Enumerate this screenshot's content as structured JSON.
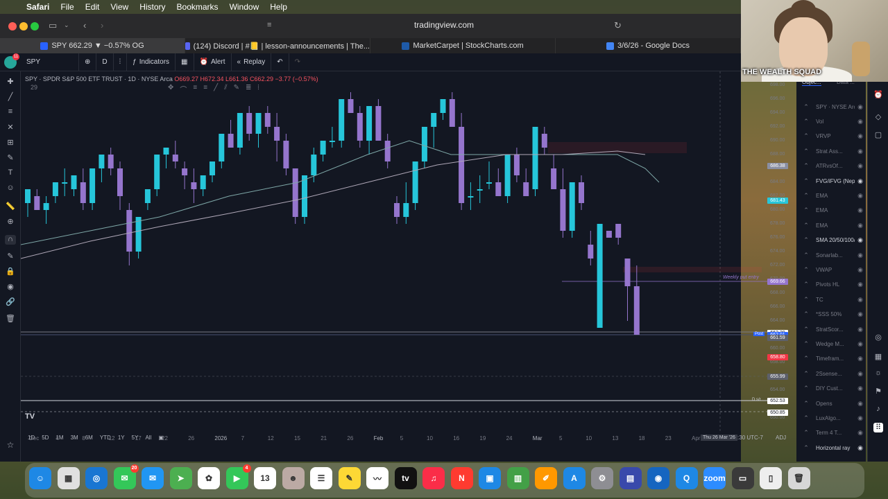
{
  "menubar": {
    "app": "Safari",
    "items": [
      "File",
      "Edit",
      "View",
      "History",
      "Bookmarks",
      "Window",
      "Help"
    ]
  },
  "browser": {
    "url": "tradingview.com",
    "tabs": [
      {
        "label": "SPY 662.29 ▼ −0.57% OG",
        "color": "#2962ff"
      },
      {
        "label": "(124) Discord | #📒 | lesson-announcements | The...",
        "color": "#5865f2"
      },
      {
        "label": "MarketCarpet | StockCharts.com",
        "color": "#1e5aa8"
      },
      {
        "label": "3/6/26 - Google Docs",
        "color": "#4285f4"
      }
    ]
  },
  "tv": {
    "avatar_badge": "11",
    "symbol": "SPY",
    "interval": "D",
    "indicators_label": "Indicators",
    "alert_label": "Alert",
    "replay_label": "Replay",
    "legend_title": "SPY · SPDR S&P 500 ETF TRUST · 1D · NYSE Arca",
    "legend_values": "O669.27 H672.34 L661.36 C662.29 −3.77 (−0.57%)",
    "legend_sub": "29",
    "annotation": "Weekly put entry",
    "time_ticks": [
      "Dec",
      "4",
      "8",
      "12",
      "17",
      "22",
      "26",
      "2026",
      "7",
      "12",
      "15",
      "21",
      "26",
      "Feb",
      "5",
      "10",
      "16",
      "19",
      "24",
      "Mar",
      "5",
      "10",
      "13",
      "18",
      "23",
      "Apr"
    ],
    "crosshair_date": "Thu 26 Mar '26",
    "ranges": [
      "1D",
      "5D",
      "1M",
      "3M",
      "6M",
      "YTD",
      "1Y",
      "5Y",
      "All"
    ],
    "clock": "13:26:30 UTC-7",
    "adj": "ADJ",
    "price_ticks": [
      "698.00",
      "696.00",
      "694.00",
      "692.00",
      "690.00",
      "688.00",
      "686.00",
      "684.00",
      "682.00",
      "680.00",
      "678.00",
      "676.00",
      "674.00",
      "672.00",
      "670.00",
      "668.00",
      "666.00",
      "664.00",
      "662.00",
      "660.00",
      "658.00",
      "656.00",
      "654.00",
      "652.00",
      "650.00"
    ],
    "price_labels": [
      {
        "text": "686.38",
        "color": "#8a8fa3"
      },
      {
        "text": "681.43",
        "color": "#26c6da"
      },
      {
        "text": "669.66",
        "color": "#9575cd"
      },
      {
        "text": "662.29",
        "color": "#ffffff"
      },
      {
        "text": "662.01",
        "color": "#2962ff"
      },
      {
        "text": "661.59",
        "color": "#5d606b"
      },
      {
        "text": "658.80",
        "color": "#f23645"
      },
      {
        "text": "655.99",
        "color": "#5d606b"
      },
      {
        "text": "652.53",
        "color": "#ffffff"
      },
      {
        "text": "650.85",
        "color": "#ffffff"
      }
    ],
    "post_label": "Post",
    "ds_label": "D s/r"
  },
  "object_tree": {
    "tab_objects": "Objec...",
    "tab_data": "Data ...",
    "rows": [
      {
        "name": "SPY · NYSE Arca, D",
        "on": false
      },
      {
        "name": "Vol",
        "on": false
      },
      {
        "name": "VRVP",
        "on": false
      },
      {
        "name": "Strat Ass...",
        "on": false
      },
      {
        "name": "ATRvsOf...",
        "on": false
      },
      {
        "name": "FVG/iFVG (Nephe...",
        "on": true
      },
      {
        "name": "EMA",
        "on": false
      },
      {
        "name": "EMA",
        "on": false
      },
      {
        "name": "EMA",
        "on": false
      },
      {
        "name": "SMA 20/50/100/2...",
        "on": true
      },
      {
        "name": "Sonarlab...",
        "on": false
      },
      {
        "name": "VWAP",
        "on": false
      },
      {
        "name": "Pivots HL",
        "on": false
      },
      {
        "name": "TC",
        "on": false
      },
      {
        "name": "*SSS 50%",
        "on": false
      },
      {
        "name": "StratScor...",
        "on": false
      },
      {
        "name": "Wedge M...",
        "on": false
      },
      {
        "name": "Timefram...",
        "on": false
      },
      {
        "name": "2Ssense...",
        "on": false
      },
      {
        "name": "DIY Cust...",
        "on": false
      },
      {
        "name": "Opens",
        "on": false
      },
      {
        "name": "LuxAlgo...",
        "on": false
      },
      {
        "name": "Term 4 T...",
        "on": false
      },
      {
        "name": "Horizontal ray",
        "on": true
      }
    ]
  },
  "webcam": {
    "caption": "THE WEALTH SQUAD"
  },
  "dock": {
    "apps": [
      {
        "name": "finder",
        "color": "#1e88e5",
        "glyph": "☺",
        "badge": ""
      },
      {
        "name": "launchpad",
        "color": "#e0e0e0",
        "glyph": "▦",
        "badge": ""
      },
      {
        "name": "safari",
        "color": "#1976d2",
        "glyph": "◎",
        "badge": ""
      },
      {
        "name": "messages",
        "color": "#34c759",
        "glyph": "✉",
        "badge": "20"
      },
      {
        "name": "mail",
        "color": "#2196f3",
        "glyph": "✉",
        "badge": ""
      },
      {
        "name": "maps",
        "color": "#4caf50",
        "glyph": "➤",
        "badge": ""
      },
      {
        "name": "photos",
        "color": "#ffffff",
        "glyph": "✿",
        "badge": ""
      },
      {
        "name": "facetime",
        "color": "#34c759",
        "glyph": "▶",
        "badge": "4"
      },
      {
        "name": "calendar",
        "color": "#ffffff",
        "glyph": "13",
        "badge": ""
      },
      {
        "name": "contacts",
        "color": "#bcaaa4",
        "glyph": "☻",
        "badge": ""
      },
      {
        "name": "reminders",
        "color": "#ffffff",
        "glyph": "☰",
        "badge": ""
      },
      {
        "name": "notes",
        "color": "#fdd835",
        "glyph": "✎",
        "badge": ""
      },
      {
        "name": "freeform",
        "color": "#ffffff",
        "glyph": "〰",
        "badge": ""
      },
      {
        "name": "tv",
        "color": "#111111",
        "glyph": "tv",
        "badge": ""
      },
      {
        "name": "music",
        "color": "#fa2d48",
        "glyph": "♫",
        "badge": ""
      },
      {
        "name": "news",
        "color": "#ff3b30",
        "glyph": "N",
        "badge": ""
      },
      {
        "name": "keynote",
        "color": "#1e88e5",
        "glyph": "▣",
        "badge": ""
      },
      {
        "name": "numbers",
        "color": "#43a047",
        "glyph": "▥",
        "badge": ""
      },
      {
        "name": "pages",
        "color": "#ff9800",
        "glyph": "✐",
        "badge": ""
      },
      {
        "name": "app-store",
        "color": "#1e88e5",
        "glyph": "A",
        "badge": ""
      },
      {
        "name": "settings",
        "color": "#8e8e93",
        "glyph": "⚙",
        "badge": ""
      },
      {
        "name": "preview",
        "color": "#3949ab",
        "glyph": "▤",
        "badge": ""
      },
      {
        "name": "finder-2",
        "color": "#1565c0",
        "glyph": "◉",
        "badge": ""
      },
      {
        "name": "quicktime",
        "color": "#1e88e5",
        "glyph": "Q",
        "badge": ""
      },
      {
        "name": "zoom",
        "color": "#2d8cff",
        "glyph": "zoom",
        "badge": ""
      },
      {
        "name": "folder",
        "color": "#3a3a3a",
        "glyph": "▭",
        "badge": ""
      },
      {
        "name": "document",
        "color": "#eeeeee",
        "glyph": "▯",
        "badge": ""
      },
      {
        "name": "trash",
        "color": "#d7d7d7",
        "glyph": "🗑",
        "badge": ""
      }
    ]
  }
}
